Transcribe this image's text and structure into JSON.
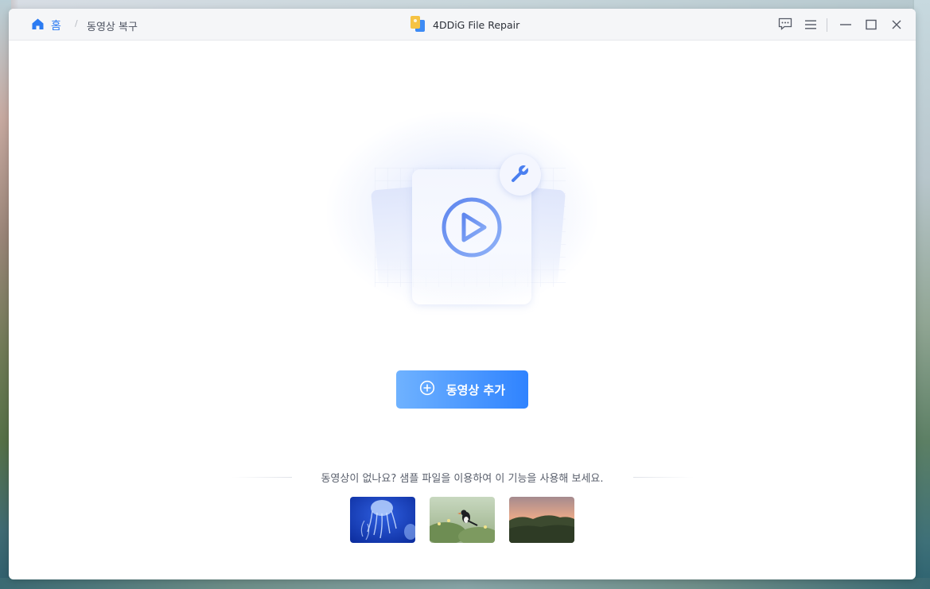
{
  "window": {
    "app_title": "4DDiG File Repair"
  },
  "breadcrumb": {
    "home_label": "홈",
    "separator": "/",
    "current": "동영상 복구"
  },
  "controls": {
    "icons": [
      "feedback-icon",
      "menu-icon",
      "minimize-icon",
      "maximize-icon",
      "close-icon"
    ]
  },
  "main": {
    "add_button_label": "동영상 추가",
    "sample_prompt": "동영상이 없나요? 샘플 파일을 이용하여 이 기능을 사용해 보세요.",
    "samples": [
      "jellyfish-sample",
      "puffin-sample",
      "sunset-hills-sample"
    ]
  },
  "colors": {
    "accent": "#2f83ff",
    "accent_light": "#6fb2ff",
    "play_icon": "#6f97ee"
  }
}
